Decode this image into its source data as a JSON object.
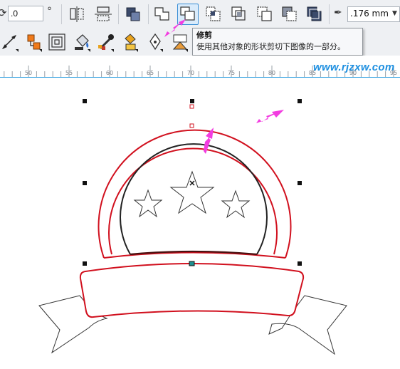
{
  "toolbar": {
    "rotation_value": ".0",
    "outline_width": ".176 mm"
  },
  "tooltip": {
    "title": "修剪",
    "description": "使用其他对象的形状剪切下图像的一部分。"
  },
  "ruler": {
    "labels": [
      "50",
      "55",
      "60",
      "65",
      "70",
      "75",
      "80",
      "85",
      "90",
      "95"
    ]
  },
  "watermark": "www.rjzxw.com",
  "colors": {
    "toolbar_bg": "#eef0f3",
    "accent_blue": "#2f9ee0",
    "outline_red": "#d1101e",
    "annotation_arrow": "#f23ce0",
    "watermark": "#1d8fe0"
  }
}
